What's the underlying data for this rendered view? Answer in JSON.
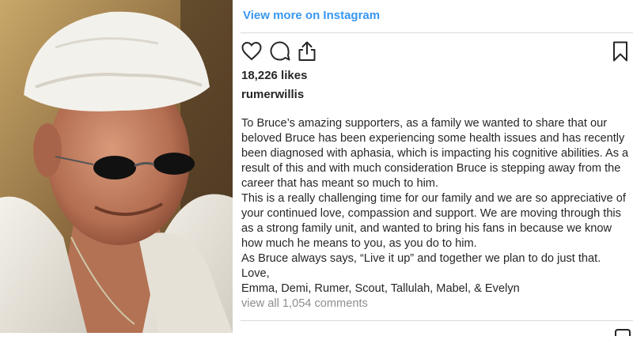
{
  "header": {
    "view_more": "View more on Instagram"
  },
  "actions": {
    "icons": [
      "heart-icon",
      "comment-icon",
      "share-icon",
      "bookmark-icon"
    ]
  },
  "post": {
    "likes": "18,226 likes",
    "username": "rumerwillis",
    "caption": [
      "To Bruce’s amazing supporters, as a family we wanted to share that our beloved Bruce has been experiencing some health issues and has recently been diagnosed with aphasia, which is impacting his cognitive abilities. As a result of this and with much consideration Bruce is stepping away from the career that has meant so much to him.",
      "This is a really challenging time for our family and we are so appreciative of your continued love, compassion and support. We are moving through this as a strong family unit, and wanted to bring his fans in because we know how much he means to you, as you do to him.",
      "As Bruce always says, “Live it up” and together we plan to do just that.",
      "Love,",
      "Emma, Demi, Rumer, Scout, Tallulah, Mabel, & Evelyn"
    ],
    "view_comments": "view all 1,054 comments"
  },
  "colors": {
    "link": "#3897f0",
    "text": "#262626",
    "muted": "#8e8e8e",
    "divider": "#dbdbdb"
  }
}
